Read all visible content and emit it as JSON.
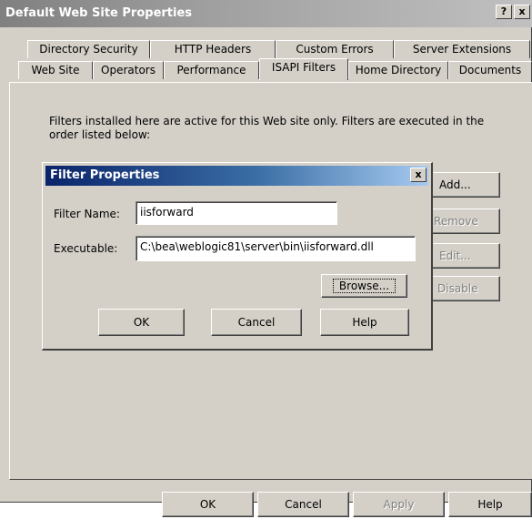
{
  "window": {
    "title": "Default Web Site Properties",
    "help_glyph": "?",
    "close_glyph": "x"
  },
  "tabs": {
    "row_back": [
      "Directory Security",
      "HTTP Headers",
      "Custom Errors",
      "Server Extensions"
    ],
    "row_front": [
      "Web Site",
      "Operators",
      "Performance",
      "ISAPI Filters",
      "Home Directory",
      "Documents"
    ],
    "active": "ISAPI Filters"
  },
  "panel": {
    "description": "Filters installed here are active for this Web site only. Filters are executed in the order listed below:",
    "buttons": {
      "add": "Add...",
      "remove": "Remove",
      "edit": "Edit...",
      "disable": "Disable"
    }
  },
  "dialog": {
    "title": "Filter Properties",
    "close_glyph": "x",
    "filter_name_label": "Filter Name:",
    "filter_name_value": "iisforward",
    "executable_label": "Executable:",
    "executable_value": "C:\\bea\\weblogic81\\server\\bin\\iisforward.dll",
    "browse": "Browse...",
    "ok": "OK",
    "cancel": "Cancel",
    "help": "Help"
  },
  "footer": {
    "ok": "OK",
    "cancel": "Cancel",
    "apply": "Apply",
    "help": "Help"
  },
  "colors": {
    "face": "#d4d0c8",
    "dialog_title_start": "#0a246a",
    "dialog_title_end": "#a6caf0",
    "window_title_inactive": "#808080"
  }
}
